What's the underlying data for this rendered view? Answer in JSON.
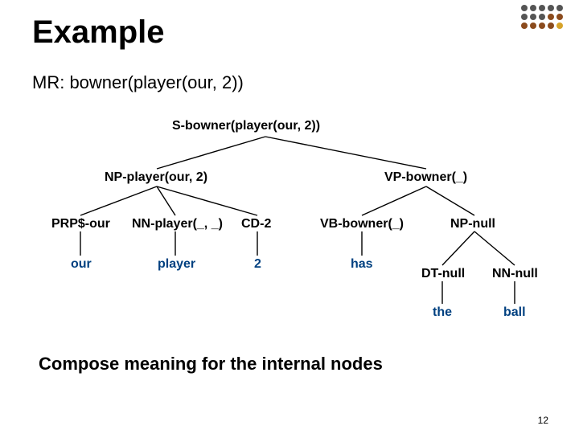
{
  "title": "Example",
  "mr": "MR: bowner(player(our, 2))",
  "nodes": {
    "s": "S-bowner(player(our, 2))",
    "np": "NP-player(our, 2)",
    "vp": "VP-bowner(_)",
    "prp": "PRP$-our",
    "nn": "NN-player(_, _)",
    "cd": "CD-2",
    "vb": "VB-bowner(_)",
    "np2": "NP-null",
    "dt": "DT-null",
    "nn2": "NN-null"
  },
  "leaves": {
    "our": "our",
    "player": "player",
    "two": "2",
    "has": "has",
    "the": "the",
    "ball": "ball"
  },
  "caption": "Compose meaning for the internal nodes",
  "page": "12"
}
